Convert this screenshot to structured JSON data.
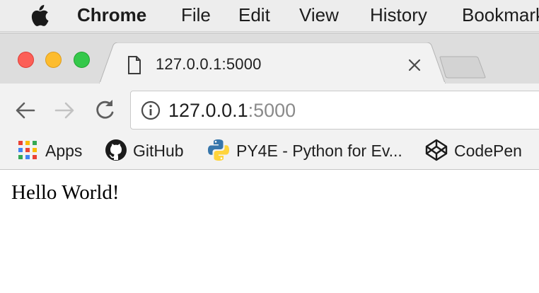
{
  "menubar": {
    "app_name": "Chrome",
    "items": [
      "File",
      "Edit",
      "View",
      "History",
      "Bookmarks"
    ]
  },
  "tab": {
    "title": "127.0.0.1:5000"
  },
  "omnibox": {
    "host": "127.0.0.1",
    "port": ":5000"
  },
  "bookmarks": {
    "apps": "Apps",
    "github": "GitHub",
    "py4e": "PY4E - Python for Ev...",
    "codepen": "CodePen"
  },
  "page": {
    "heading": "Hello World!"
  },
  "colors": {
    "close": "#fc5f57",
    "minimize": "#fdbc2e",
    "zoom": "#34c84a",
    "python_blue": "#3776ab",
    "python_yellow": "#ffd43b"
  }
}
